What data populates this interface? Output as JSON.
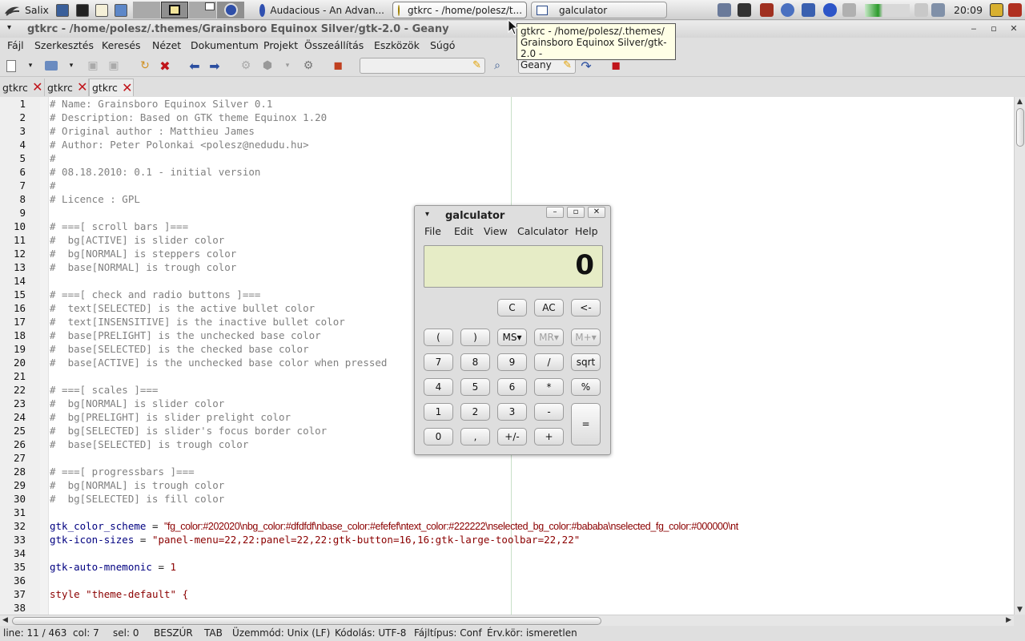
{
  "panel": {
    "start_label": "Salix",
    "tasks": [
      {
        "label": "Audacious - An Advan..."
      },
      {
        "label": "gtkrc - /home/polesz/t..."
      },
      {
        "label": "galculator"
      }
    ],
    "clock": "20:09"
  },
  "window": {
    "title": "gtkrc - /home/polesz/.themes/Grainsboro Equinox Silver/gtk-2.0 - Geany"
  },
  "menubar": [
    "Fájl",
    "Szerkesztés",
    "Keresés",
    "Nézet",
    "Dokumentum",
    "Projekt",
    "Összeállítás",
    "Eszközök",
    "Súgó"
  ],
  "tabs": [
    {
      "label": "gtkrc"
    },
    {
      "label": "gtkrc"
    },
    {
      "label": "gtkrc"
    }
  ],
  "tooltip": {
    "line1": "gtkrc - /home/polesz/.themes/",
    "line2": "Grainsboro Equinox Silver/gtk-2.0 -",
    "line3": "Geany"
  },
  "editor": {
    "line_numbers": [
      "1",
      "2",
      "3",
      "4",
      "5",
      "6",
      "7",
      "8",
      "9",
      "10",
      "11",
      "12",
      "13",
      "14",
      "15",
      "16",
      "17",
      "18",
      "19",
      "20",
      "21",
      "22",
      "23",
      "24",
      "25",
      "26",
      "27",
      "28",
      "29",
      "30",
      "31",
      "32",
      "33",
      "34",
      "35",
      "36",
      "37",
      "38"
    ],
    "comments": {
      "l1": "# Name: Grainsboro Equinox Silver 0.1",
      "l2": "# Description: Based on GTK theme Equinox 1.20",
      "l3": "# Original author : Matthieu James",
      "l4": "# Author: Peter Polonkai <polesz@nedudu.hu>",
      "l5": "#",
      "l6": "# 08.18.2010: 0.1 - initial version",
      "l7": "#",
      "l8": "# Licence : GPL",
      "l10": "# ===[ scroll bars ]===",
      "l11": "#  bg[ACTIVE] is slider color",
      "l12": "#  bg[NORMAL] is steppers color",
      "l13": "#  base[NORMAL] is trough color",
      "l15": "# ===[ check and radio buttons ]===",
      "l16": "#  text[SELECTED] is the active bullet color",
      "l17": "#  text[INSENSITIVE] is the inactive bullet color",
      "l18": "#  base[PRELIGHT] is the unchecked base color",
      "l19": "#  base[SELECTED] is the checked base color",
      "l20": "#  base[ACTIVE] is the unchecked base color when pressed",
      "l22": "# ===[ scales ]===",
      "l23": "#  bg[NORMAL] is slider color",
      "l24": "#  bg[PRELIGHT] is slider prelight color",
      "l25": "#  bg[SELECTED] is slider's focus border color",
      "l26": "#  base[SELECTED] is trough color",
      "l28": "# ===[ progressbars ]===",
      "l29": "#  bg[NORMAL] is trough color",
      "l30": "#  bg[SELECTED] is fill color"
    },
    "l32": {
      "key": "gtk_color_scheme",
      "op": " = ",
      "value": "\"fg_color:#202020\\nbg_color:#dfdfdf\\nbase_color:#efefef\\ntext_color:#222222\\nselected_bg_color:#bababa\\nselected_fg_color:#000000\\nt"
    },
    "l33": {
      "key": "gtk-icon-sizes",
      "op": " = ",
      "value": "\"panel-menu=22,22:panel=22,22:gtk-button=16,16:gtk-large-toolbar=22,22\""
    },
    "l35": {
      "key": "gtk-auto-mnemonic",
      "op": " = ",
      "value": "1"
    },
    "l37": {
      "key": "style",
      "value": " \"theme-default\"",
      "op": " {"
    }
  },
  "status": {
    "line": "line: 11 / 463",
    "col": "col: 7",
    "sel": "sel: 0",
    "mode": "BESZÚR",
    "indent": "TAB",
    "eol": "Üzemmód: Unix (LF)",
    "encoding": "Kódolás: UTF-8",
    "filetype": "Fájltípus: Conf",
    "scope": "Érv.kör: ismeretlen"
  },
  "calculator": {
    "title": "galculator",
    "menu": [
      "File",
      "Edit",
      "View",
      "Calculator",
      "Help"
    ],
    "display": "0",
    "keys": {
      "clear": "C",
      "all_clear": "AC",
      "backspace": "<-",
      "paren_open": "(",
      "paren_close": ")",
      "ms": "MS▾",
      "mr": "MR▾",
      "mplus": "M+▾",
      "k7": "7",
      "k8": "8",
      "k9": "9",
      "div": "/",
      "sqrt": "sqrt",
      "k4": "4",
      "k5": "5",
      "k6": "6",
      "mul": "*",
      "pct": "%",
      "k1": "1",
      "k2": "2",
      "k3": "3",
      "sub": "-",
      "eq": "=",
      "k0": "0",
      "dot": ",",
      "neg": "+/-",
      "add": "+"
    }
  },
  "colors": {
    "comment": "#808080",
    "keyword": "#000080",
    "string": "#8b0000",
    "tab_close": "#c0141a",
    "calc_display": "#e6ecc6"
  }
}
